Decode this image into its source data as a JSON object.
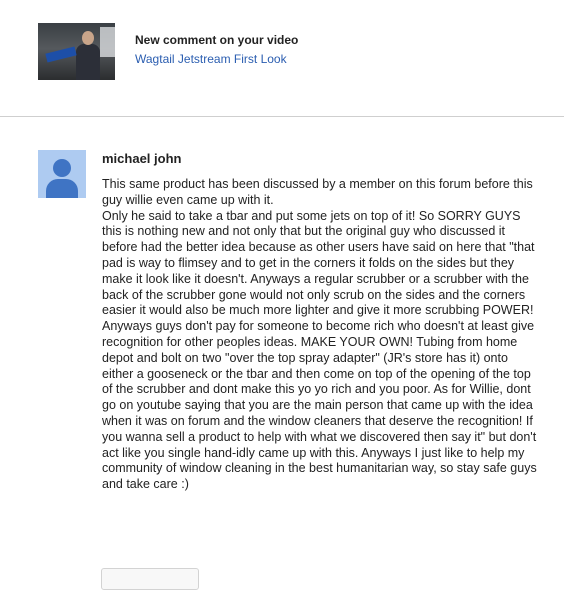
{
  "notification": {
    "title": "New comment on your video",
    "video_title": "Wagtail Jetstream First Look",
    "thumbnail_icon": "video-thumbnail"
  },
  "comment": {
    "author": "michael john",
    "avatar_icon": "default-user-avatar-icon",
    "paragraphs": [
      "This same product has been discussed by a member on this forum before this guy willie even came up with it.",
      "Only he said to take a tbar and put some jets on top of it! So SORRY GUYS this is nothing new and not only that but the original guy who discussed it before had the better idea because as other users have said on here that \"that pad is way to flimsey and to get in the corners it folds on the sides but they make it look like it doesn't. Anyways a regular scrubber or a scrubber with the back of the scrubber gone would not only scrub on the sides and the corners easier it would also be much more lighter and give it more scrubbing POWER! Anyways guys don't pay for someone to become rich who doesn't at least give recognition for other peoples ideas. MAKE YOUR OWN! Tubing from home depot and bolt on two \"over the top spray adapter\" (JR's store has it) onto either a gooseneck or the tbar and then come on top of the opening of the top of the scrubber and dont make this yo yo rich and you poor. As for Willie, dont go on youtube saying that you are the main person that came up with the idea when it was on forum and the window cleaners that deserve the recognition! If you wanna sell a product to help with what we discovered then say it\" but don't act like you single hand-idly came up with this. Anyways I just like to help my community of window cleaning in the best humanitarian way, so stay safe guys and take care :)"
    ]
  },
  "colors": {
    "link": "#2a5db0",
    "avatar_background": "#aecbf1",
    "avatar_figure": "#3f74c4",
    "divider": "#cfcfcf"
  }
}
